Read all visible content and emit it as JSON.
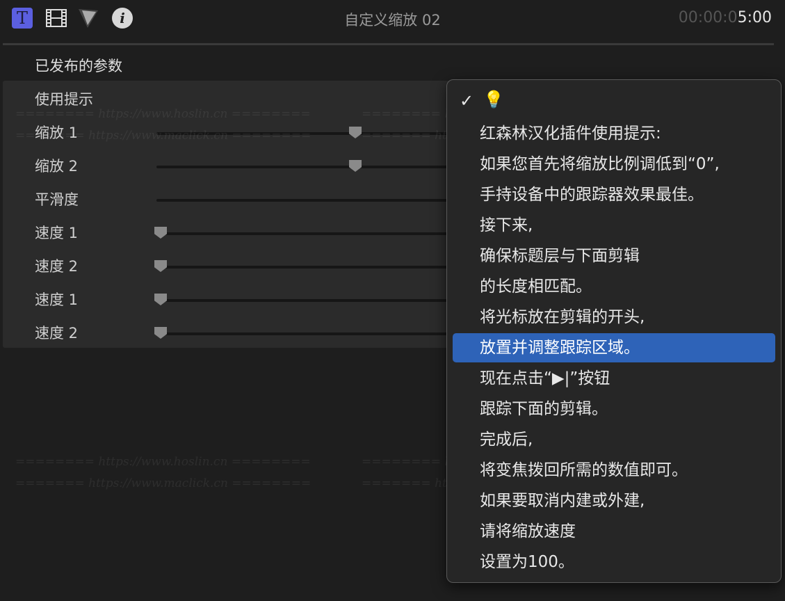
{
  "header": {
    "title": "自定义缩放 02",
    "timecode_dim": "00:00:0",
    "timecode_bright": "5:00",
    "icons": [
      "text-icon",
      "film-icon",
      "shape-icon",
      "info-icon"
    ],
    "text_icon_letter": "T",
    "info_icon_letter": "i"
  },
  "section_title": "已发布的参数",
  "params": [
    {
      "label": "使用提示",
      "type": "popup"
    },
    {
      "label": "缩放 1",
      "value": 0.5
    },
    {
      "label": "缩放 2",
      "value": 0.5
    },
    {
      "label": "平滑度",
      "value": null
    },
    {
      "label": "速度 1",
      "value": 0.0
    },
    {
      "label": "速度 2",
      "value": 0.0
    },
    {
      "label": "速度 1",
      "value": 0.0
    },
    {
      "label": "速度 2",
      "value": 0.0
    }
  ],
  "watermarks": [
    "======== https://www.hoslin.cn ========",
    "======= https://www.maclick.cn ========"
  ],
  "menu": {
    "checked_icon": "💡",
    "check": "✓",
    "items": [
      "红森林汉化插件使用提示:",
      "如果您首先将缩放比例调低到“0”,",
      "手持设备中的跟踪器效果最佳。",
      "接下来,",
      "确保标题层与下面剪辑",
      "的长度相匹配。",
      "将光标放在剪辑的开头,",
      "放置并调整跟踪区域。",
      "现在点击“▶|”按钮",
      "跟踪下面的剪辑。",
      "完成后,",
      "将变焦拨回所需的数值即可。",
      "如果要取消内建或外建,",
      "请将缩放速度",
      "设置为100。"
    ],
    "selected_index": 7
  }
}
